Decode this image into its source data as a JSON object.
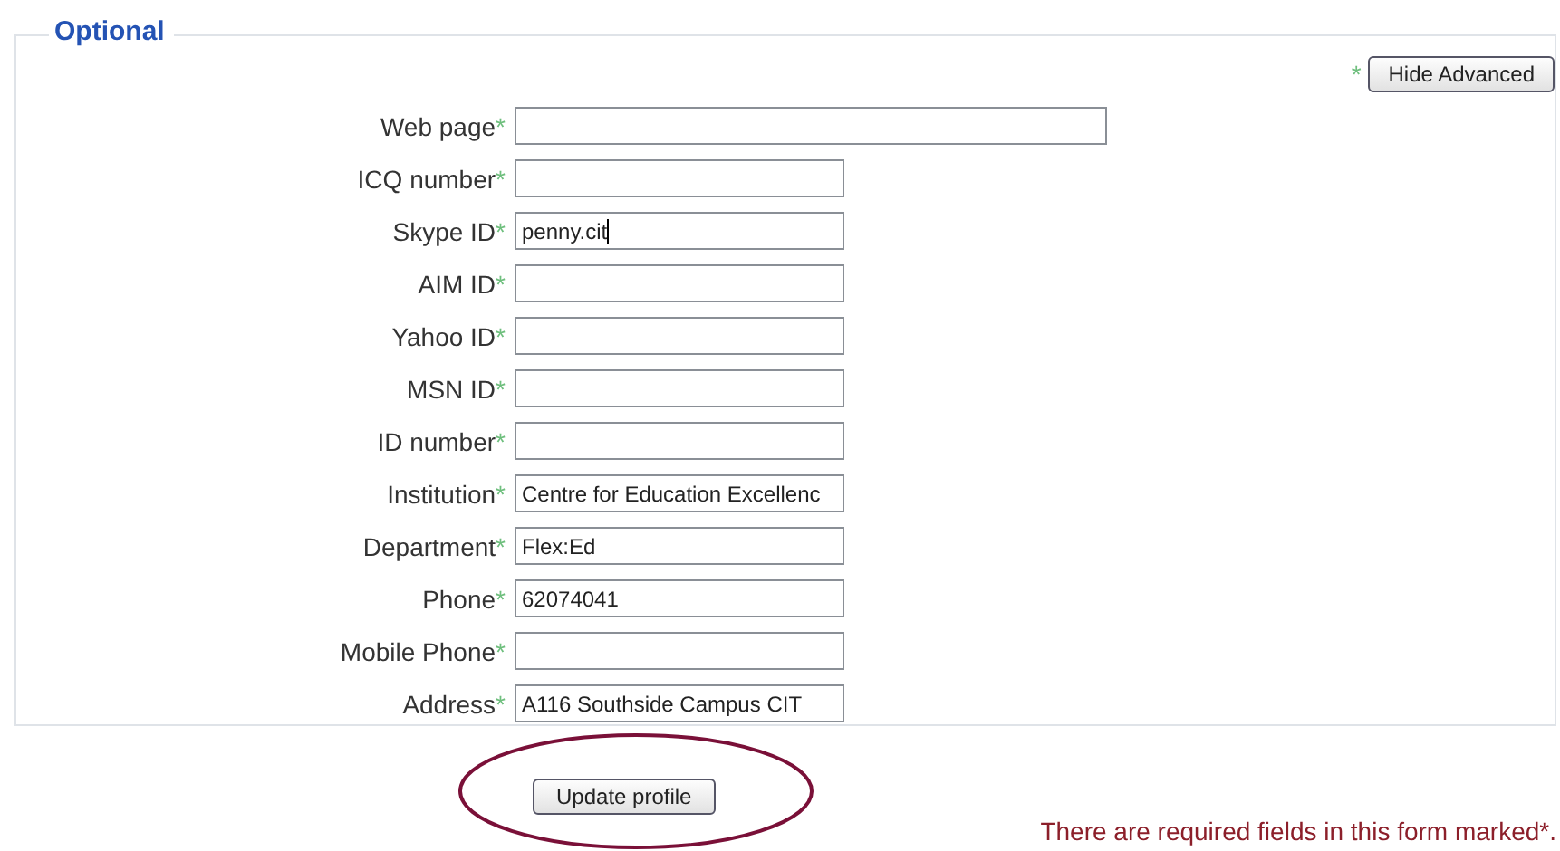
{
  "fieldset": {
    "legend": "Optional",
    "toggle": {
      "marker": "*",
      "label": "Hide Advanced"
    },
    "fields": [
      {
        "label": "Web page",
        "marker": "*",
        "kind": "wide"
      },
      {
        "label": "ICQ number",
        "marker": "*",
        "kind": "short"
      },
      {
        "label": "Skype ID",
        "marker": "*",
        "value": "penny.cit",
        "kind": "short",
        "focused": true
      },
      {
        "label": "AIM ID",
        "marker": "*",
        "kind": "short"
      },
      {
        "label": "Yahoo ID",
        "marker": "*",
        "kind": "short"
      },
      {
        "label": "MSN ID",
        "marker": "*",
        "kind": "short"
      },
      {
        "label": "ID number",
        "marker": "*",
        "kind": "short"
      },
      {
        "label": "Institution",
        "marker": "*",
        "value": "Centre for Education Excellenc",
        "kind": "short"
      },
      {
        "label": "Department",
        "marker": "*",
        "value": "Flex:Ed",
        "kind": "short"
      },
      {
        "label": "Phone",
        "marker": "*",
        "value": "62074041",
        "kind": "short"
      },
      {
        "label": "Mobile Phone",
        "marker": "*",
        "kind": "short"
      },
      {
        "label": "Address",
        "marker": "*",
        "value": "A116 Southside Campus CIT",
        "kind": "short"
      }
    ]
  },
  "submit": {
    "label": "Update profile",
    "circled": true
  },
  "notice": "There are required fields in this form marked*."
}
